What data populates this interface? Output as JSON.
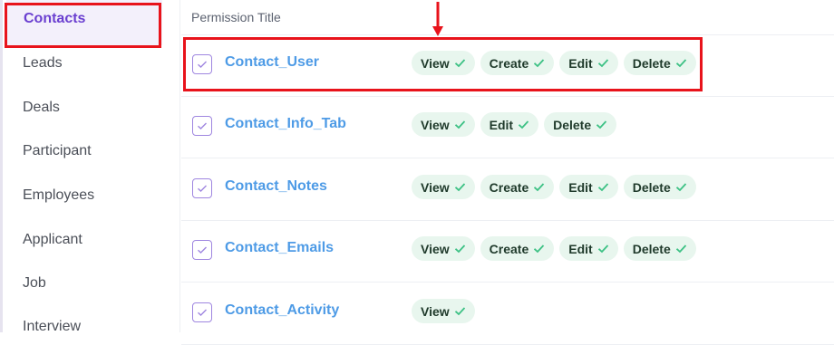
{
  "sidebar": {
    "active": "Contacts",
    "items": [
      "Leads",
      "Deals",
      "Participant",
      "Employees",
      "Applicant",
      "Job",
      "Interview"
    ]
  },
  "table": {
    "header": "Permission Title",
    "rows": [
      {
        "name": "Contact_User",
        "chips": [
          "View",
          "Create",
          "Edit",
          "Delete"
        ]
      },
      {
        "name": "Contact_Info_Tab",
        "chips": [
          "View",
          "Edit",
          "Delete"
        ]
      },
      {
        "name": "Contact_Notes",
        "chips": [
          "View",
          "Create",
          "Edit",
          "Delete"
        ]
      },
      {
        "name": "Contact_Emails",
        "chips": [
          "View",
          "Create",
          "Edit",
          "Delete"
        ]
      },
      {
        "name": "Contact_Activity",
        "chips": [
          "View"
        ]
      }
    ]
  },
  "colors": {
    "accent_purple": "#6a3fd0",
    "link_blue": "#4e9be6",
    "chip_bg": "#e8f6ee",
    "check_green": "#3cc184",
    "highlight_red": "#e8131b"
  },
  "icons": {
    "row_checkbox": "check-square-icon",
    "chip_check": "check-icon",
    "annotation": "arrow-down-icon"
  }
}
